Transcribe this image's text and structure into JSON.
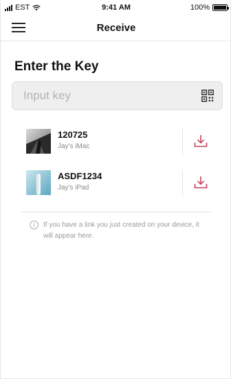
{
  "status_bar": {
    "carrier": "EST",
    "time": "9:41 AM",
    "battery": "100%",
    "battery_level": 1.0
  },
  "nav": {
    "title": "Receive"
  },
  "main": {
    "heading": "Enter the Key",
    "key_input": {
      "placeholder": "Input key",
      "value": ""
    }
  },
  "devices": [
    {
      "name": "120725",
      "owner": "Jay's iMac"
    },
    {
      "name": "ASDF1234",
      "owner": "Jay's iPad"
    }
  ],
  "info": {
    "text": "If you have a link you just created on your device, it will appear here."
  },
  "colors": {
    "accent": "#c2405b",
    "text_dark": "#111111",
    "text_muted": "#999999",
    "field_bg": "#efefef"
  },
  "icons": [
    "menu-icon",
    "qr-code-icon",
    "download-icon",
    "info-icon",
    "wifi-icon",
    "signal-icon",
    "battery-icon"
  ]
}
